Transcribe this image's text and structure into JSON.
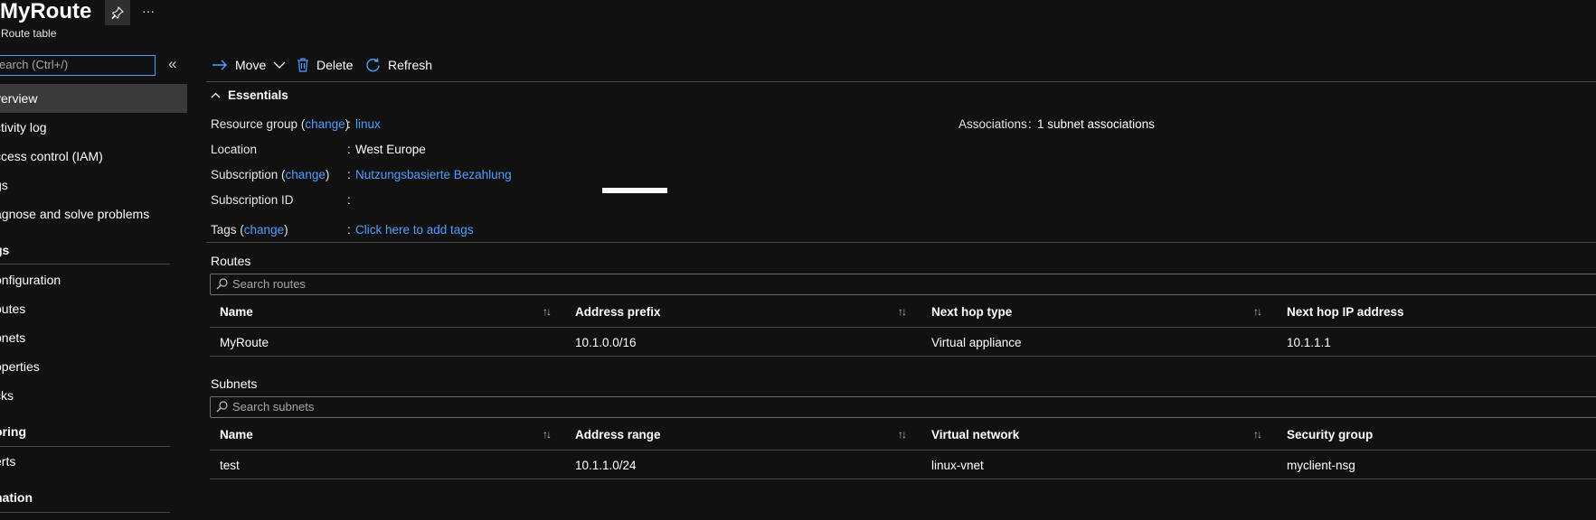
{
  "header": {
    "title": "MyRoute",
    "subtitle": "Route table",
    "more_label": "···"
  },
  "sidebar": {
    "search_placeholder": "earch (Ctrl+/)",
    "collapse_glyph": "«",
    "items": [
      {
        "label": "verview",
        "selected": true
      },
      {
        "label": "ctivity log"
      },
      {
        "label": "ccess control (IAM)"
      },
      {
        "label": "gs"
      },
      {
        "label": "agnose and solve problems"
      }
    ],
    "settings_group": "gs",
    "settings_items": [
      {
        "label": "onfiguration"
      },
      {
        "label": "outes"
      },
      {
        "label": "bnets"
      },
      {
        "label": "operties"
      },
      {
        "label": "cks"
      }
    ],
    "monitoring_group": "oring",
    "monitoring_items": [
      {
        "label": "erts"
      }
    ],
    "automation_group": "nation"
  },
  "toolbar": {
    "move_label": "Move",
    "delete_label": "Delete",
    "refresh_label": "Refresh"
  },
  "essentials": {
    "title": "Essentials",
    "resource_group_label": "Resource group",
    "change_label": "change",
    "resource_group_value": "linux",
    "location_label": "Location",
    "location_value": "West Europe",
    "subscription_label": "Subscription",
    "subscription_value": "Nutzungsbasierte Bezahlung",
    "subscription_id_label": "Subscription ID",
    "tags_label": "Tags",
    "tags_value": "Click here to add tags",
    "associations_label": "Associations",
    "associations_value": "1 subnet associations"
  },
  "routes": {
    "title": "Routes",
    "search_placeholder": "Search routes",
    "columns": [
      "Name",
      "Address prefix",
      "Next hop type",
      "Next hop IP address"
    ],
    "rows": [
      [
        "MyRoute",
        "10.1.0.0/16",
        "Virtual appliance",
        "10.1.1.1"
      ]
    ]
  },
  "subnets": {
    "title": "Subnets",
    "search_placeholder": "Search subnets",
    "columns": [
      "Name",
      "Address range",
      "Virtual network",
      "Security group"
    ],
    "rows": [
      [
        "test",
        "10.1.1.0/24",
        "linux-vnet",
        "myclient-nsg"
      ]
    ]
  },
  "colors": {
    "background": "#111111",
    "link": "#4f9eff",
    "selected_item": "#3a3a3a",
    "focus_border": "#4f9eff"
  }
}
